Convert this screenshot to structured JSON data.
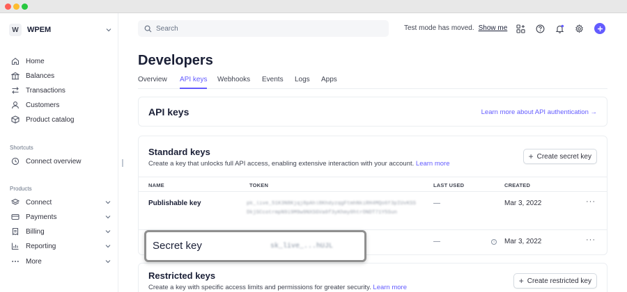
{
  "account": {
    "badge": "W",
    "name": "WPEM"
  },
  "sidebar": {
    "main": [
      {
        "label": "Home",
        "icon": "home-icon"
      },
      {
        "label": "Balances",
        "icon": "balances-icon"
      },
      {
        "label": "Transactions",
        "icon": "transactions-icon"
      },
      {
        "label": "Customers",
        "icon": "customers-icon"
      },
      {
        "label": "Product catalog",
        "icon": "product-catalog-icon"
      }
    ],
    "shortcuts_title": "Shortcuts",
    "shortcuts": [
      {
        "label": "Connect overview",
        "icon": "connect-overview-icon"
      }
    ],
    "products_title": "Products",
    "products": [
      {
        "label": "Connect",
        "icon": "connect-icon"
      },
      {
        "label": "Payments",
        "icon": "payments-icon"
      },
      {
        "label": "Billing",
        "icon": "billing-icon"
      },
      {
        "label": "Reporting",
        "icon": "reporting-icon"
      },
      {
        "label": "More",
        "icon": "more-icon"
      }
    ]
  },
  "topbar": {
    "search_placeholder": "Search",
    "notice_text": "Test mode has moved.",
    "notice_link": "Show me"
  },
  "page": {
    "title": "Developers",
    "tabs": [
      "Overview",
      "API keys",
      "Webhooks",
      "Events",
      "Logs",
      "Apps"
    ],
    "active_tab": "API keys"
  },
  "api_keys_card": {
    "title": "API keys",
    "link": "Learn more about API authentication →"
  },
  "standard_keys": {
    "title": "Standard keys",
    "description": "Create a key that unlocks full API access, enabling extensive interaction with your account.",
    "learn_more": "Learn more",
    "create_button": "Create secret key",
    "columns": [
      "NAME",
      "TOKEN",
      "LAST USED",
      "CREATED"
    ],
    "rows": [
      {
        "name": "Publishable key",
        "token": "pk_live_51K3N8Kjqj8pAhl8KhdyzqgFtmhNkiRH4MQo6f3pIUvKSSDkjSCcotrmpN9i9M9w9NXSGVa0f3yKhmy0htrONDT71Y5Sun",
        "last_used": "—",
        "created": "Mar 3, 2022"
      },
      {
        "name": "Secret key",
        "token": "sk_live_...hUJL",
        "last_used": "—",
        "created": "Mar 3, 2022"
      }
    ]
  },
  "restricted_keys": {
    "title": "Restricted keys",
    "description": "Create a key with specific access limits and permissions for greater security.",
    "learn_more": "Learn more",
    "create_button": "Create restricted key"
  },
  "colors": {
    "accent": "#635bff",
    "text": "#1a1f36",
    "muted": "#687385"
  }
}
